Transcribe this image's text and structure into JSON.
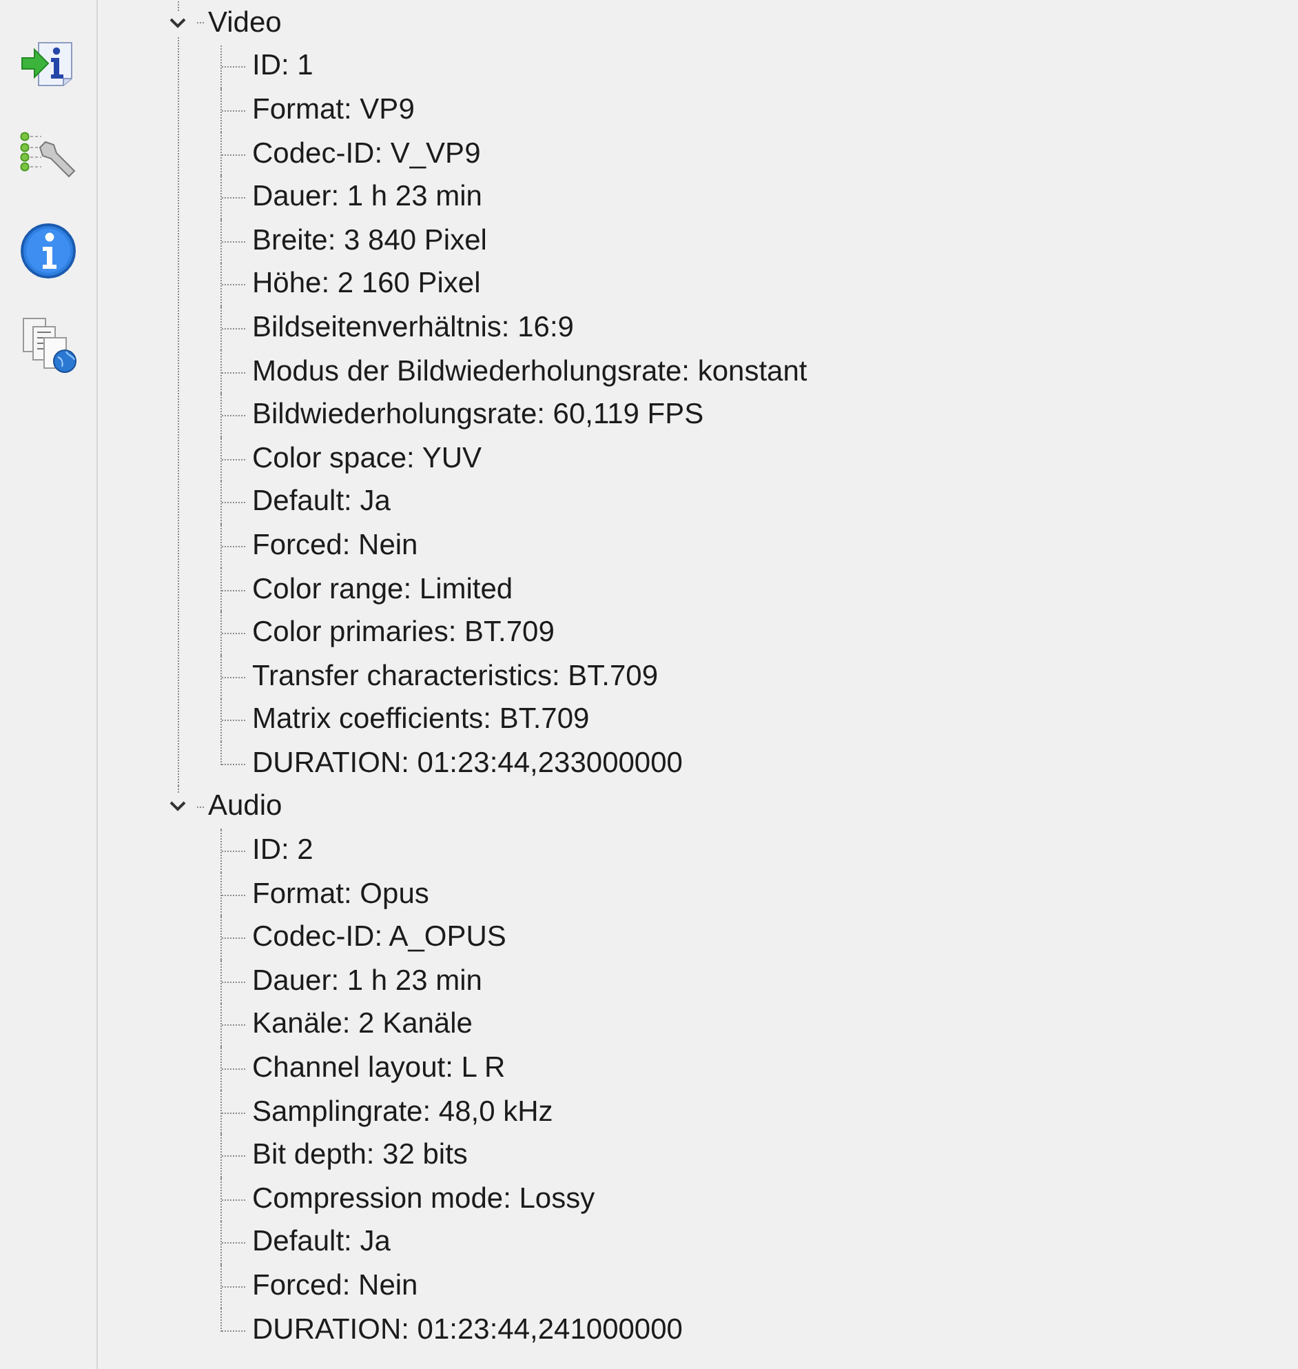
{
  "tree": [
    {
      "label": "Video",
      "expanded": true,
      "children": [
        {
          "label": "ID: 1"
        },
        {
          "label": "Format: VP9"
        },
        {
          "label": "Codec-ID: V_VP9"
        },
        {
          "label": "Dauer: 1 h 23 min"
        },
        {
          "label": "Breite: 3 840 Pixel"
        },
        {
          "label": "Höhe: 2 160 Pixel"
        },
        {
          "label": "Bildseitenverhältnis: 16:9"
        },
        {
          "label": "Modus der Bildwiederholungsrate: konstant"
        },
        {
          "label": "Bildwiederholungsrate: 60,119 FPS"
        },
        {
          "label": "Color space: YUV"
        },
        {
          "label": "Default: Ja"
        },
        {
          "label": "Forced: Nein"
        },
        {
          "label": "Color range: Limited"
        },
        {
          "label": "Color primaries: BT.709"
        },
        {
          "label": "Transfer characteristics: BT.709"
        },
        {
          "label": "Matrix coefficients: BT.709"
        },
        {
          "label": "DURATION: 01:23:44,233000000"
        }
      ]
    },
    {
      "label": "Audio",
      "expanded": true,
      "children": [
        {
          "label": "ID: 2"
        },
        {
          "label": "Format: Opus"
        },
        {
          "label": "Codec-ID: A_OPUS"
        },
        {
          "label": "Dauer: 1 h 23 min"
        },
        {
          "label": "Kanäle: 2 Kanäle"
        },
        {
          "label": "Channel layout: L R"
        },
        {
          "label": "Samplingrate: 48,0 kHz"
        },
        {
          "label": "Bit depth: 32 bits"
        },
        {
          "label": "Compression mode: Lossy"
        },
        {
          "label": "Default: Ja"
        },
        {
          "label": "Forced: Nein"
        },
        {
          "label": "DURATION: 01:23:44,241000000"
        }
      ]
    }
  ]
}
